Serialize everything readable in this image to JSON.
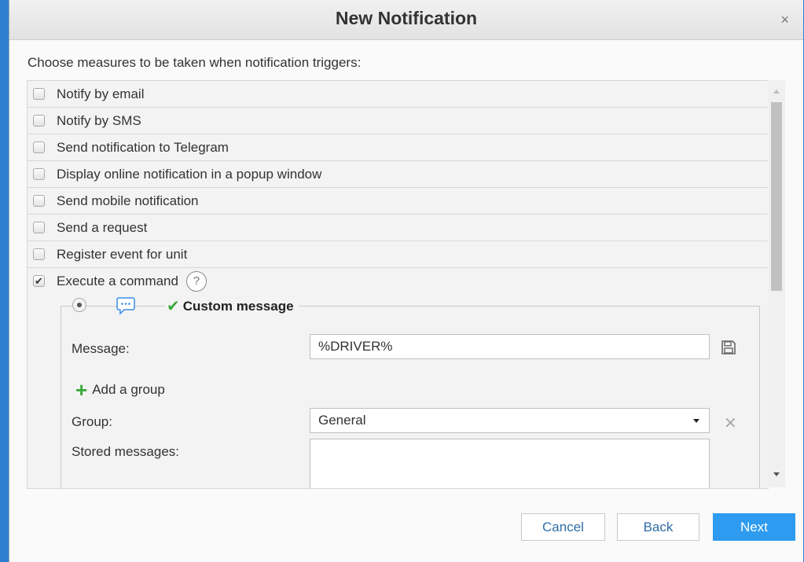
{
  "dialog": {
    "title": "New Notification",
    "close_glyph": "×",
    "prompt": "Choose measures to be taken when notification triggers:"
  },
  "actions": [
    {
      "label": "Notify by email",
      "checked": false
    },
    {
      "label": "Notify by SMS",
      "checked": false
    },
    {
      "label": "Send notification to Telegram",
      "checked": false
    },
    {
      "label": "Display online notification in a popup window",
      "checked": false
    },
    {
      "label": "Send mobile notification",
      "checked": false
    },
    {
      "label": "Send a request",
      "checked": false
    },
    {
      "label": "Register event for unit",
      "checked": false
    },
    {
      "label": "Execute a command",
      "checked": true
    }
  ],
  "command": {
    "help_glyph": "?",
    "legend": "Custom message",
    "message_label": "Message:",
    "message_value": "%DRIVER%",
    "add_group_label": "Add a group",
    "group_label": "Group:",
    "group_value": "General",
    "stored_label": "Stored messages:"
  },
  "footer": {
    "cancel": "Cancel",
    "back": "Back",
    "next": "Next"
  },
  "colors": {
    "accent": "#2e9bf0",
    "success": "#3aa83a"
  },
  "icons": [
    "close-icon",
    "help-icon",
    "chat-icon",
    "checkmark-icon",
    "save-icon",
    "plus-icon",
    "chevron-down-icon",
    "clear-icon"
  ]
}
